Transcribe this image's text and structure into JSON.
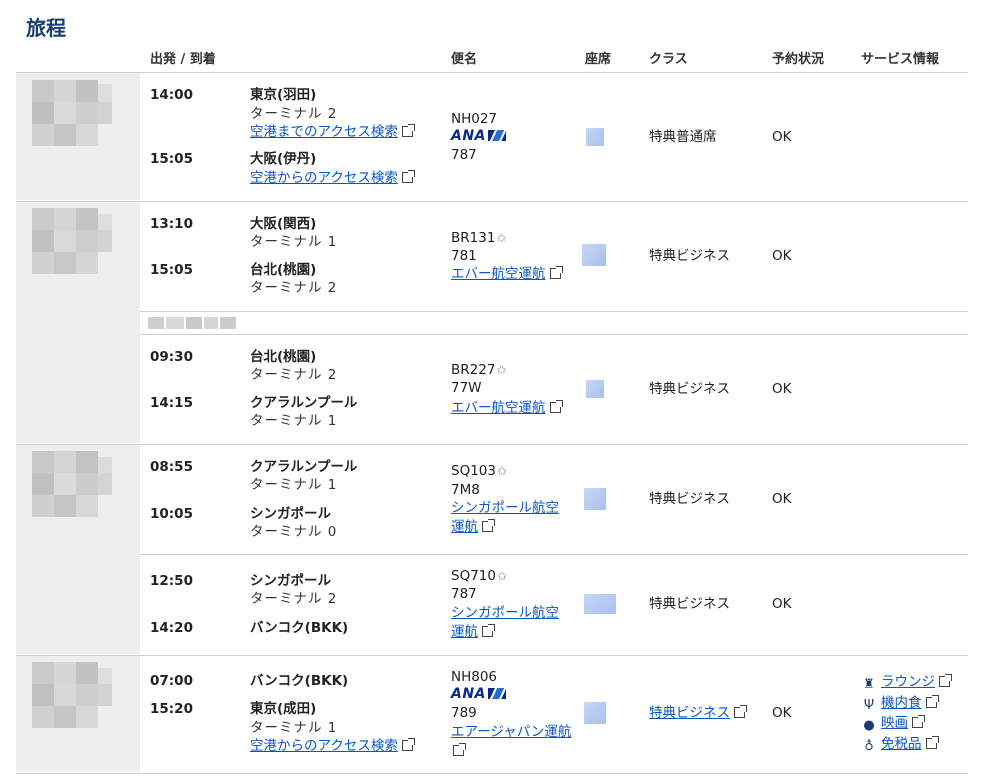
{
  "title": "旅程",
  "headers": {
    "depart_arrive": "出発 / 到着",
    "flight": "便名",
    "seat": "座席",
    "class": "クラス",
    "status": "予約状況",
    "service": "サービス情報"
  },
  "segments": [
    {
      "dep_time": "14:00",
      "arr_time": "15:05",
      "dep_airport": "東京(羽田)",
      "dep_terminal": "ターミナル 2",
      "dep_access": "空港までのアクセス検索",
      "arr_airport": "大阪(伊丹)",
      "arr_access": "空港からのアクセス検索",
      "flight_no": "NH027",
      "airline_logo": "ANA",
      "aircraft": "787",
      "class": "特典普通席",
      "status": "OK"
    },
    {
      "dep_time": "13:10",
      "arr_time": "15:05",
      "dep_airport": "大阪(関西)",
      "dep_terminal": "ターミナル 1",
      "arr_airport": "台北(桃園)",
      "arr_terminal": "ターミナル 2",
      "flight_no": "BR131",
      "aircraft": "781",
      "operated_by": "エバー航空運航",
      "class": "特典ビジネス",
      "status": "OK"
    },
    {
      "dep_time": "09:30",
      "arr_time": "14:15",
      "dep_airport": "台北(桃園)",
      "dep_terminal": "ターミナル 2",
      "arr_airport": "クアラルンプール",
      "arr_terminal": "ターミナル 1",
      "flight_no": "BR227",
      "aircraft": "77W",
      "operated_by": "エバー航空運航",
      "class": "特典ビジネス",
      "status": "OK"
    },
    {
      "dep_time": "08:55",
      "arr_time": "10:05",
      "dep_airport": "クアラルンプール",
      "dep_terminal": "ターミナル 1",
      "arr_airport": "シンガポール",
      "arr_terminal": "ターミナル 0",
      "flight_no": "SQ103",
      "aircraft": "7M8",
      "operated_by_1": "シンガポール航空",
      "operated_by_2": "運航",
      "class": "特典ビジネス",
      "status": "OK"
    },
    {
      "dep_time": "12:50",
      "arr_time": "14:20",
      "dep_airport": "シンガポール",
      "dep_terminal": "ターミナル 2",
      "arr_airport": "バンコク(BKK)",
      "flight_no": "SQ710",
      "aircraft": "787",
      "operated_by_1": "シンガポール航空",
      "operated_by_2": "運航",
      "class": "特典ビジネス",
      "status": "OK"
    },
    {
      "dep_time": "07:00",
      "arr_time": "15:20",
      "dep_airport": "バンコク(BKK)",
      "arr_airport": "東京(成田)",
      "arr_terminal": "ターミナル 1",
      "arr_access": "空港からのアクセス検索",
      "flight_no": "NH806",
      "airline_logo": "ANA",
      "aircraft": "789",
      "operated_by": "エアージャパン運航",
      "class": "特典ビジネス",
      "status": "OK",
      "services": [
        "ラウンジ",
        "機内食",
        "映画",
        "免税品"
      ]
    }
  ],
  "colors": {
    "title": "#1a3d6d",
    "link": "#0b55c4",
    "ana_blue": "#0a2a8a"
  }
}
